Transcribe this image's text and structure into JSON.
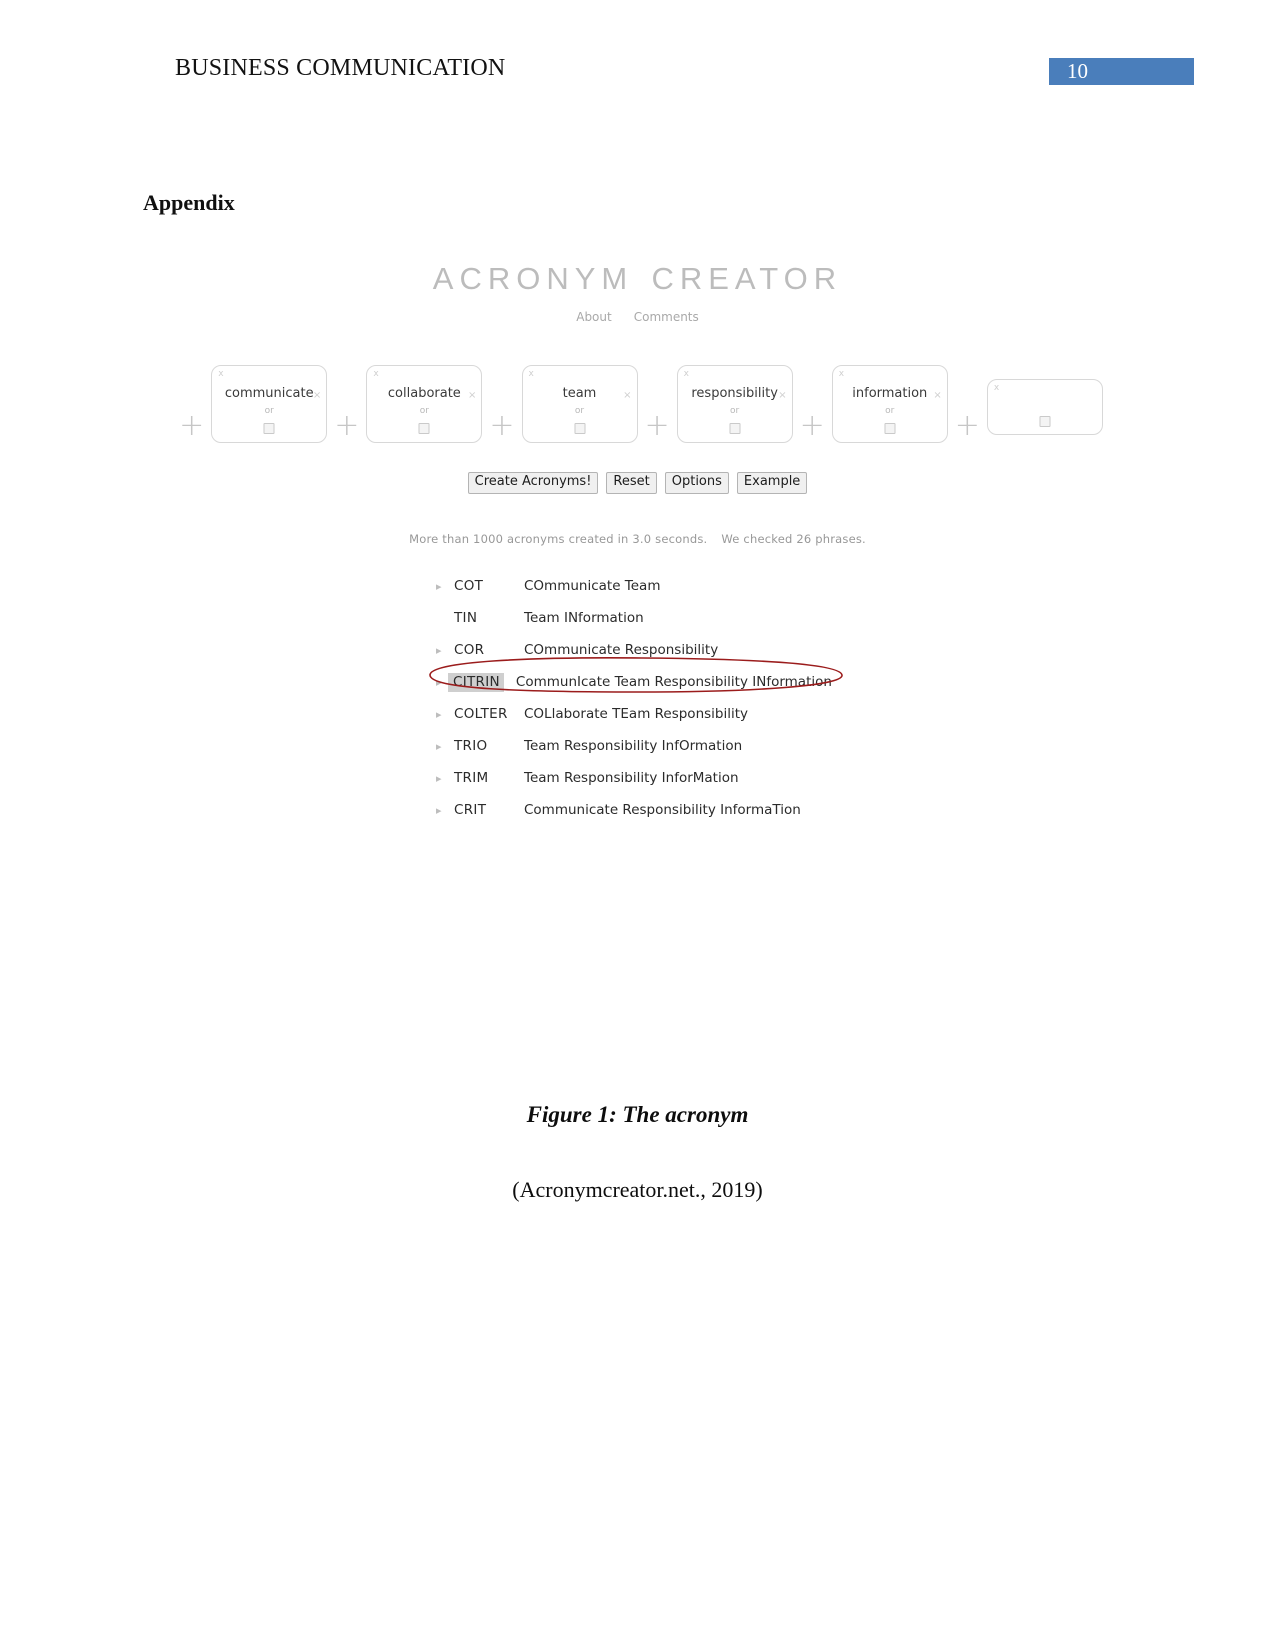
{
  "document": {
    "header_title": "BUSINESS COMMUNICATION",
    "page_number": "10",
    "page_number_bg": "#4a7ebb",
    "appendix_heading": "Appendix",
    "figure_caption": "Figure 1: The acronym",
    "figure_citation": "(Acronymcreator.net., 2019)"
  },
  "app": {
    "title": "Acronym Creator",
    "nav": [
      {
        "label": "About"
      },
      {
        "label": "Comments"
      }
    ],
    "word_boxes": [
      {
        "word": "communicate",
        "or_label": "or",
        "close_label": "x",
        "clear_label": "×",
        "empty": false
      },
      {
        "word": "collaborate",
        "or_label": "or",
        "close_label": "x",
        "clear_label": "×",
        "empty": false
      },
      {
        "word": "team",
        "or_label": "or",
        "close_label": "x",
        "clear_label": "×",
        "empty": false
      },
      {
        "word": "responsibility",
        "or_label": "or",
        "close_label": "x",
        "clear_label": "×",
        "empty": false
      },
      {
        "word": "information",
        "or_label": "or",
        "close_label": "x",
        "clear_label": "×",
        "empty": false
      },
      {
        "word": "",
        "or_label": "",
        "close_label": "x",
        "clear_label": "",
        "empty": true
      }
    ],
    "plus_label": "+",
    "buttons": [
      {
        "label": "Create Acronyms!"
      },
      {
        "label": "Reset"
      },
      {
        "label": "Options"
      },
      {
        "label": "Example"
      }
    ],
    "status": {
      "left": "More than 1000 acronyms created in 3.0 seconds.",
      "right": "We checked 26 phrases."
    },
    "results": [
      {
        "arrow": "▸",
        "has_arrow": true,
        "acronym": "COT",
        "phrase": "COmmunicate Team",
        "selected": false
      },
      {
        "arrow": "▸",
        "has_arrow": false,
        "acronym": "TIN",
        "phrase": "Team INformation",
        "selected": false
      },
      {
        "arrow": "▸",
        "has_arrow": true,
        "acronym": "COR",
        "phrase": "COmmunicate Responsibility",
        "selected": false
      },
      {
        "arrow": "▸",
        "has_arrow": true,
        "acronym": "CITRIN",
        "phrase": "CommunIcate Team Responsibility INformation",
        "selected": true
      },
      {
        "arrow": "▸",
        "has_arrow": true,
        "acronym": "COLTER",
        "phrase": "COLlaborate TEam Responsibility",
        "selected": false
      },
      {
        "arrow": "▸",
        "has_arrow": true,
        "acronym": "TRIO",
        "phrase": "Team Responsibility InfOrmation",
        "selected": false
      },
      {
        "arrow": "▸",
        "has_arrow": true,
        "acronym": "TRIM",
        "phrase": "Team Responsibility InforMation",
        "selected": false
      },
      {
        "arrow": "▸",
        "has_arrow": true,
        "acronym": "CRIT",
        "phrase": "Communicate Responsibility InformaTion",
        "selected": false
      }
    ],
    "annotation": {
      "color": "#9b1c1c",
      "shape": "ellipse"
    }
  }
}
